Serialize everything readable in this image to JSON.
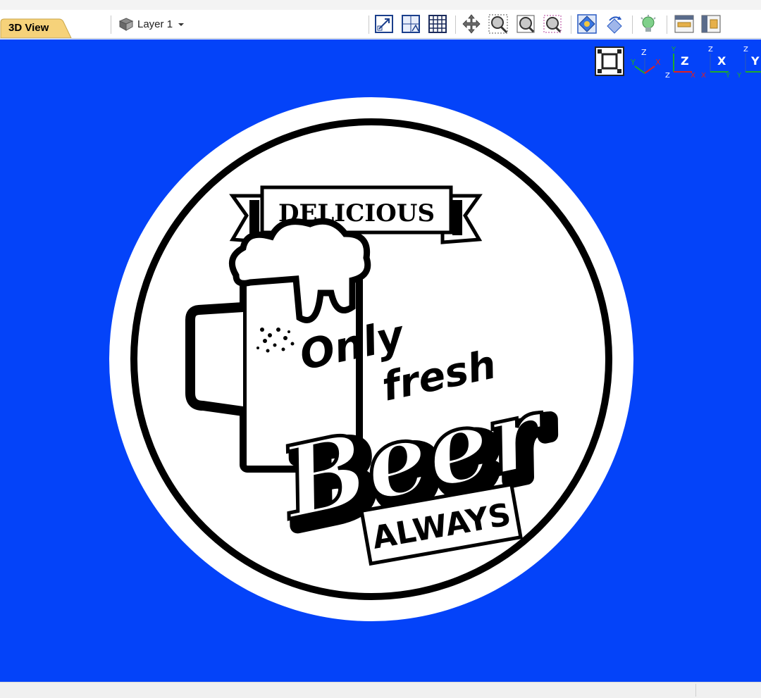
{
  "tab": {
    "label": "3D View"
  },
  "layer": {
    "label": "Layer 1",
    "icon": "layer-stack-icon"
  },
  "toolbar_icons": [
    "scale-model-icon",
    "fit-to-area-icon",
    "grid-icon",
    "pan-icon",
    "zoom-window-icon",
    "zoom-fit-icon",
    "zoom-selection-icon",
    "render-shaded-icon",
    "rotate-view-icon",
    "lighting-icon",
    "show-top-icon",
    "show-side-icon"
  ],
  "view_controls": {
    "fit_view_icon": "fit-view-icon",
    "axes": [
      {
        "name": "iso-view-icon",
        "labels": [
          "Z",
          "Y",
          "X"
        ]
      },
      {
        "name": "top-view-icon",
        "labels": [
          "Y",
          "Z",
          "Z",
          "X"
        ]
      },
      {
        "name": "front-view-icon",
        "labels": [
          "Z",
          "X",
          "X",
          "Y"
        ]
      },
      {
        "name": "side-view-icon",
        "labels": [
          "Z",
          "Y",
          "Y"
        ]
      }
    ]
  },
  "artwork": {
    "banner_text": "DELICIOUS",
    "line1": "Only",
    "line2": "fresh",
    "line3": "Beer",
    "line4": "ALWAYS"
  },
  "colors": {
    "viewport_bg": "#0443f9",
    "tab_bg": "#f6d27a",
    "axis_x": "#e02020",
    "axis_y": "#1eaa2a",
    "axis_z": "#1a4fd6"
  }
}
